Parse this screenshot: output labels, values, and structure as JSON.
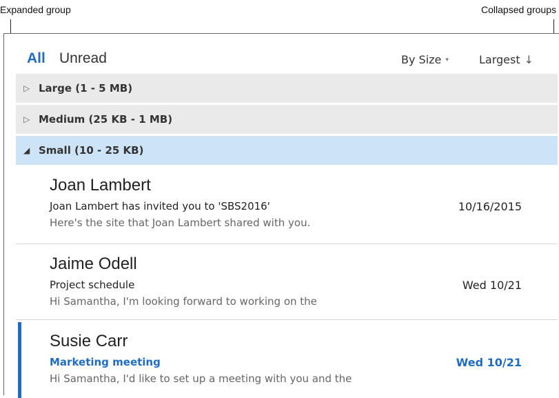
{
  "callouts": {
    "left": "Expanded group",
    "right": "Collapsed groups"
  },
  "filters": {
    "all": "All",
    "unread": "Unread",
    "sort_by": "By Size",
    "sort_order": "Largest",
    "sort_by_caret": "▾",
    "sort_order_arrow": "↓"
  },
  "groups": [
    {
      "label": "Large (1 - 5 MB)",
      "state": "collapsed",
      "glyph": "▷"
    },
    {
      "label": "Medium (25 KB - 1 MB)",
      "state": "collapsed",
      "glyph": "▷"
    },
    {
      "label": "Small (10 - 25 KB)",
      "state": "expanded",
      "glyph": "◢"
    }
  ],
  "messages": [
    {
      "sender": "Joan Lambert",
      "subject": "Joan Lambert has invited you to 'SBS2016'",
      "date": "10/16/2015",
      "preview": "Here's the site that Joan Lambert shared with you.",
      "unread": false
    },
    {
      "sender": "Jaime Odell",
      "subject": "Project schedule",
      "date": "Wed 10/21",
      "preview": "Hi Samantha,  I'm looking forward to working on the",
      "unread": false
    },
    {
      "sender": "Susie Carr",
      "subject": "Marketing meeting",
      "date": "Wed 10/21",
      "preview": "Hi Samantha,  I'd like to set up a meeting with you and the",
      "unread": true
    }
  ],
  "colors": {
    "accent": "#1f6cc0",
    "group_bg": "#eaeaea",
    "expanded_group_bg": "#cce4f6"
  }
}
